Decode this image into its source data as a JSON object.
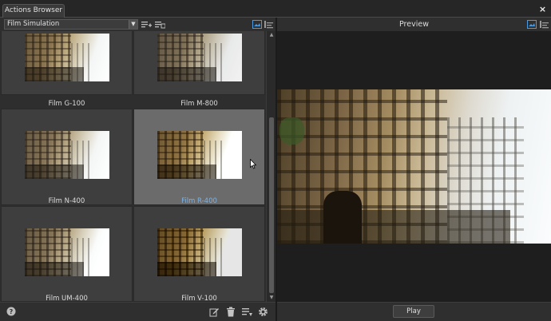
{
  "window": {
    "tab_title": "Actions Browser",
    "close_glyph": "×"
  },
  "toolbar": {
    "category": "Film Simulation",
    "icons": [
      "add-action-icon",
      "manage-list-icon",
      "thumbnail-view-icon",
      "list-view-icon"
    ]
  },
  "grid": {
    "items": [
      {
        "label": "Film G-100",
        "selected": false
      },
      {
        "label": "Film M-800",
        "selected": false
      },
      {
        "label": "Film N-400",
        "selected": false
      },
      {
        "label": "Film R-400",
        "selected": true
      },
      {
        "label": "Film UM-400",
        "selected": false
      },
      {
        "label": "Film V-100",
        "selected": false
      }
    ]
  },
  "bottombar": {
    "icons": [
      "help-icon",
      "edit-icon",
      "delete-icon",
      "list-settings-icon",
      "gear-icon"
    ]
  },
  "preview": {
    "title": "Preview",
    "play_label": "Play"
  },
  "colors": {
    "selected_label": "#7fb2e0",
    "selected_cell": "#6b6b6b",
    "cell": "#3e3e3e"
  }
}
